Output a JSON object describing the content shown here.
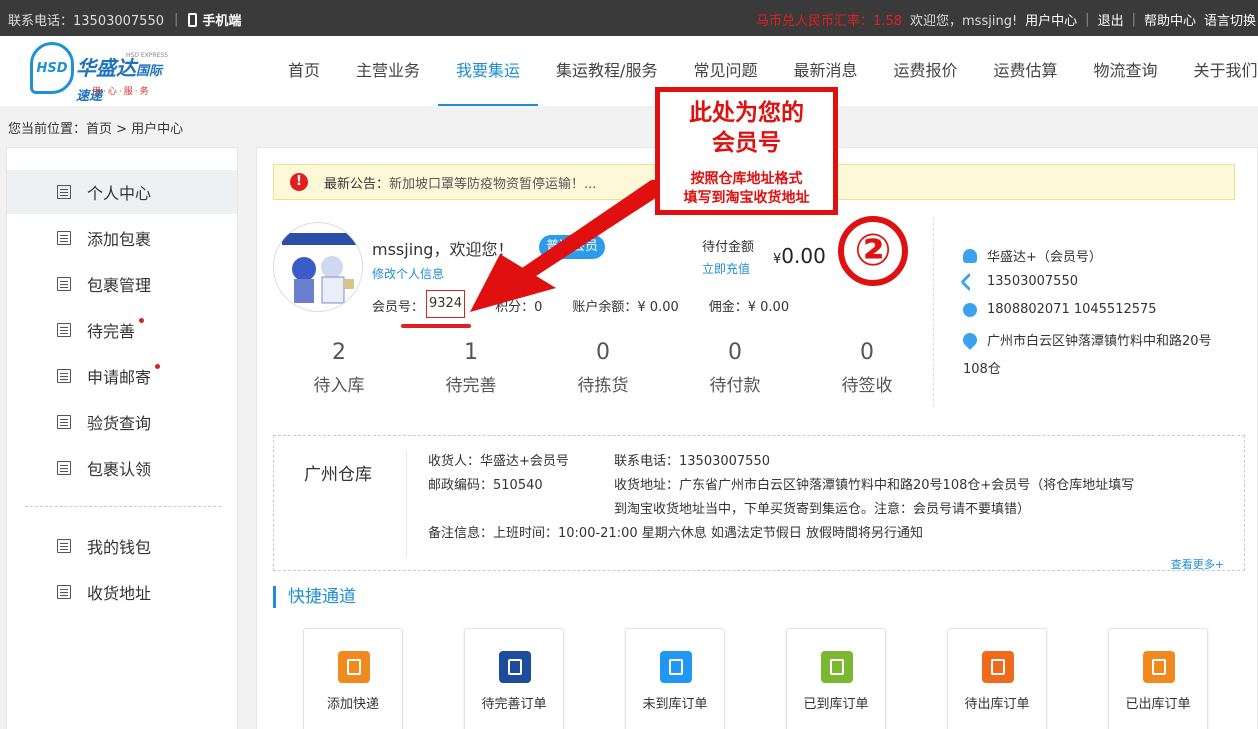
{
  "topbar": {
    "phone_label": "联系电话：13503007550",
    "separator": "|",
    "mobile_label": "手机端",
    "rate_label": "马币兑人民币汇率：",
    "rate_value": "1.58",
    "welcome": "欢迎您，mssjing!",
    "user_center": "用户中心",
    "logout": "退出",
    "help": "帮助中心",
    "language": "语言切换"
  },
  "logo": {
    "mark": "HSD",
    "name_cn": "华盛达",
    "name_suffix": "国际速递",
    "name_en": "HSD EXPRESS",
    "slogan": "用·心·服·务"
  },
  "nav": {
    "items": [
      {
        "label": "首页"
      },
      {
        "label": "主营业务"
      },
      {
        "label": "我要集运"
      },
      {
        "label": "集运教程/服务"
      },
      {
        "label": "常见问题"
      },
      {
        "label": "最新消息"
      },
      {
        "label": "运费报价"
      },
      {
        "label": "运费估算"
      },
      {
        "label": "物流查询"
      },
      {
        "label": "关于我们"
      }
    ]
  },
  "breadcrumb": "您当前位置：首页 > 用户中心",
  "sidebar": {
    "items": [
      {
        "label": "个人中心"
      },
      {
        "label": "添加包裹"
      },
      {
        "label": "包裹管理"
      },
      {
        "label": "待完善"
      },
      {
        "label": "申请邮寄"
      },
      {
        "label": "验货查询"
      },
      {
        "label": "包裹认领"
      },
      {
        "label": "我的钱包"
      },
      {
        "label": "收货地址"
      }
    ]
  },
  "notice": {
    "icon": "!",
    "title": "最新公告：",
    "text": "新加坡口罩等防疫物资暂停运输！..."
  },
  "profile": {
    "greeting": "mssjing，欢迎您！",
    "edit_link": "修改个人信息",
    "badge": "普通会员",
    "member_label": "会员号：",
    "member_no": "9324",
    "points": "积分：0",
    "balance": "账户余额：¥ 0.00",
    "commission": "佣金：¥ 0.00",
    "due_label": "待付金额",
    "topup": "立即充值",
    "due_currency": "¥",
    "due_amount": "0.00"
  },
  "stats": [
    {
      "count": "2",
      "label": "待入库"
    },
    {
      "count": "1",
      "label": "待完善"
    },
    {
      "count": "0",
      "label": "待拣货"
    },
    {
      "count": "0",
      "label": "待付款"
    },
    {
      "count": "0",
      "label": "待签收"
    }
  ],
  "contact": {
    "name": "华盛达+（会员号）",
    "phone": "13503007550",
    "qq": "1808802071  1045512575",
    "address_line1": "广州市白云区钟落潭镇竹料中和路20号",
    "address_line2": "108仓"
  },
  "warehouse": {
    "name": "广州仓库",
    "receiver": "收货人：华盛达+会员号",
    "postcode": "邮政编码：510540",
    "tel": "联系电话：13503007550",
    "addr1": "收货地址：广东省广州市白云区钟落潭镇竹料中和路20号108仓+会员号（将仓库地址填写",
    "addr2": "到淘宝收货地址当中，下单买货寄到集运仓。注意：会员号请不要填错）",
    "remark": "备注信息：上班时间：10:00-21:00 星期六休息 如遇法定节假日 放假時間将另行通知",
    "more": "查看更多+"
  },
  "quick": {
    "title": "快捷通道",
    "items": [
      {
        "label": "添加快递",
        "color": "#f08a1e"
      },
      {
        "label": "待完善订单",
        "color": "#1d4c9c"
      },
      {
        "label": "未到库订单",
        "color": "#2196f3"
      },
      {
        "label": "已到库订单",
        "color": "#7cb82f"
      },
      {
        "label": "待出库订单",
        "color": "#f06a1e"
      },
      {
        "label": "已出库订单",
        "color": "#f08a1e"
      }
    ]
  },
  "annotation": {
    "title_line1": "此处为您的",
    "title_line2": "会员号",
    "sub_line1": "按照仓库地址格式",
    "sub_line2": "填写到淘宝收货地址",
    "circle_number": "②",
    "color": "#e01010"
  }
}
